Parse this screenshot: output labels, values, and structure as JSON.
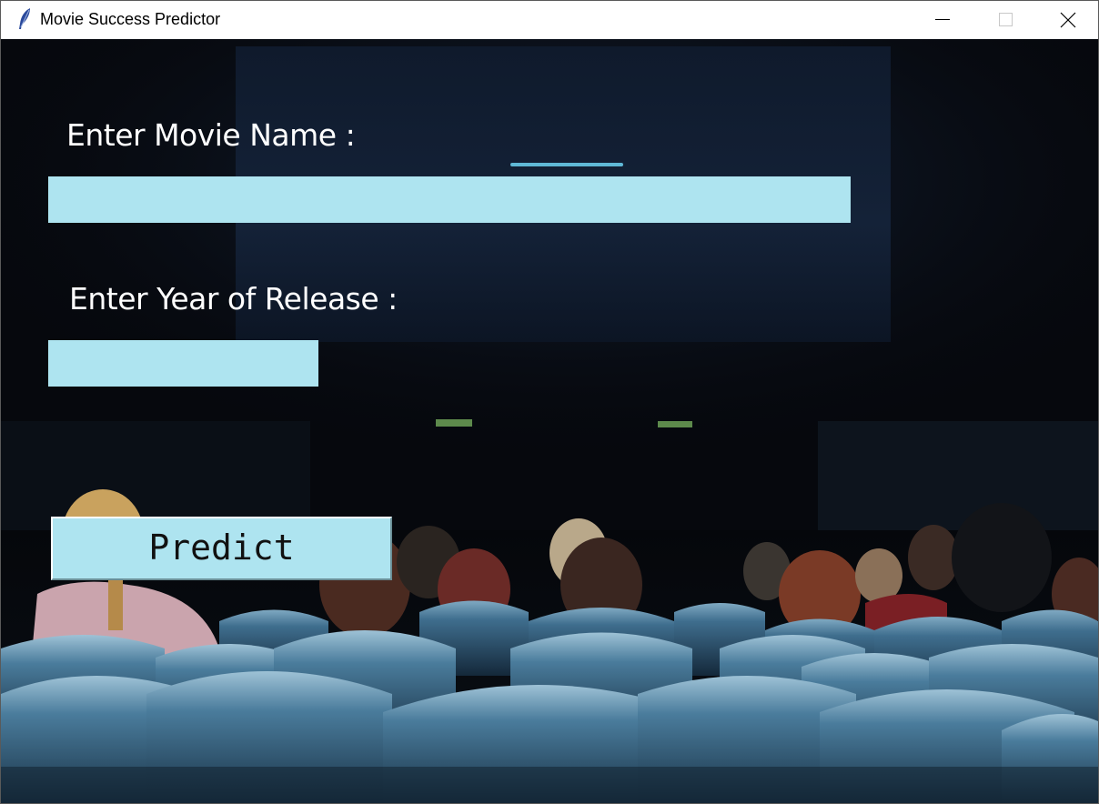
{
  "window": {
    "title": "Movie Success Predictor",
    "icon": "feather-icon",
    "controls": [
      "minimize-icon",
      "maximize-icon",
      "close-icon"
    ]
  },
  "form": {
    "movie_name_label": "Enter Movie Name :",
    "movie_name_value": "",
    "year_label": "Enter Year of Release :",
    "year_value": "",
    "predict_label": "Predict"
  },
  "colors": {
    "entry_background": "#aee4f0",
    "button_background": "#aee4f0",
    "label_text": "#ffffff"
  }
}
